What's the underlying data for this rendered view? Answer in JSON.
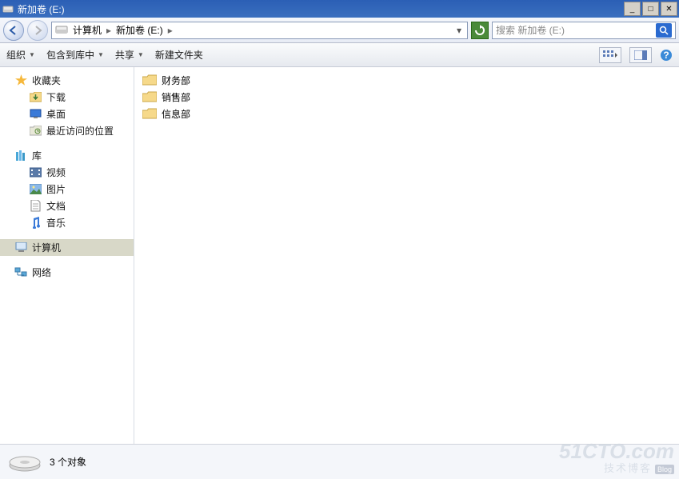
{
  "window": {
    "title": "新加卷 (E:)"
  },
  "nav": {
    "crumbs": [
      "计算机",
      "新加卷 (E:)"
    ],
    "search_placeholder": "搜索 新加卷 (E:)"
  },
  "toolbar": {
    "organize": "组织",
    "include": "包含到库中",
    "share": "共享",
    "new_folder": "新建文件夹"
  },
  "sidebar": {
    "favorites": {
      "label": "收藏夹",
      "items": [
        "下载",
        "桌面",
        "最近访问的位置"
      ]
    },
    "libraries": {
      "label": "库",
      "items": [
        "视频",
        "图片",
        "文档",
        "音乐"
      ]
    },
    "computer": {
      "label": "计算机"
    },
    "network": {
      "label": "网络"
    }
  },
  "content": {
    "folders": [
      "财务部",
      "销售部",
      "信息部"
    ]
  },
  "status": {
    "text": "3 个对象"
  },
  "watermark": {
    "big": "51CTO.com",
    "sub": "技术博客",
    "tag": "Blog"
  }
}
